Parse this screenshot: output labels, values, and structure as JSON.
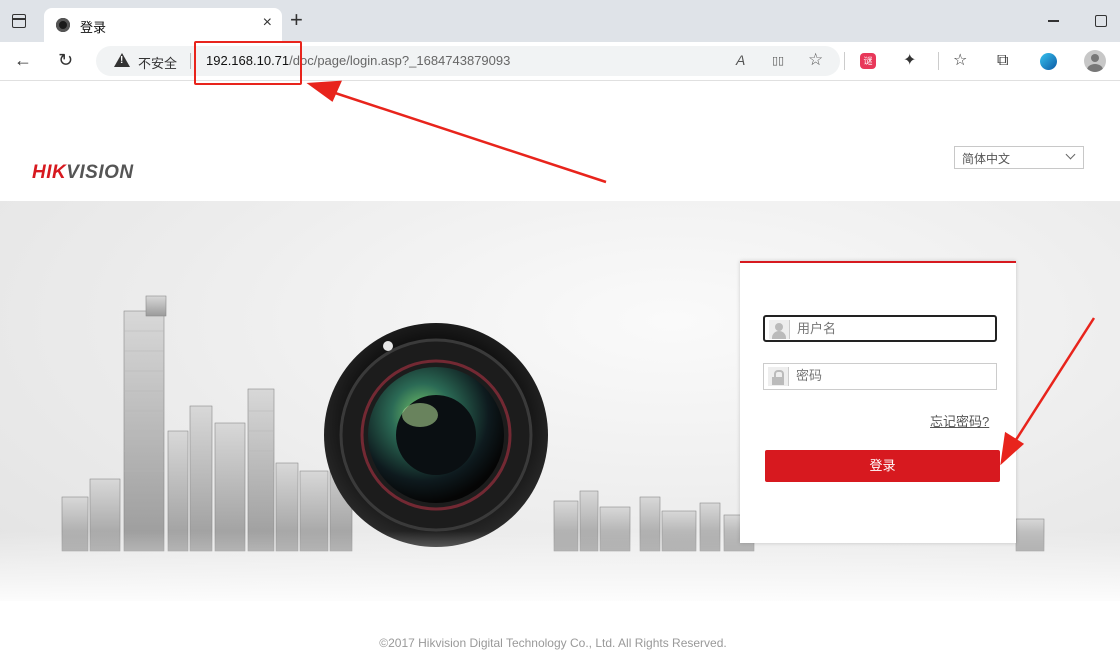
{
  "browser": {
    "tab_title": "登录",
    "tab_close": "×",
    "new_tab": "+",
    "security_label": "不安全",
    "url_host": "192.168.10.71",
    "url_path": "/doc/page/login.asp?_1684743879093",
    "back_icon": "←",
    "reload_icon": "↻",
    "read_aloud_icon": "A",
    "split_icon": "▯▯",
    "favorite_icon": "☆",
    "extensions_icon": "✦",
    "favorites_list_icon": "☆",
    "collections_icon": "⧉",
    "ext_red_label": "谜"
  },
  "page": {
    "logo_hik": "HIK",
    "logo_vision": "VISION",
    "language": "简体中文",
    "username_placeholder": "用户名",
    "password_placeholder": "密码",
    "forgot_password": "忘记密码?",
    "login_button": "登录",
    "footer": "©2017 Hikvision Digital Technology Co., Ltd. All Rights Reserved."
  },
  "colors": {
    "brand_red": "#d7191f",
    "annotation_red": "#e8241c"
  },
  "icons": [
    "window-icon",
    "favicon-icon",
    "back-icon",
    "reload-icon",
    "warning-icon",
    "read-aloud-icon",
    "split-screen-icon",
    "favorite-add-icon",
    "extensions-icon",
    "favorites-icon",
    "collections-icon",
    "edge-icon",
    "profile-icon",
    "user-icon",
    "lock-icon",
    "chevron-down-icon"
  ]
}
